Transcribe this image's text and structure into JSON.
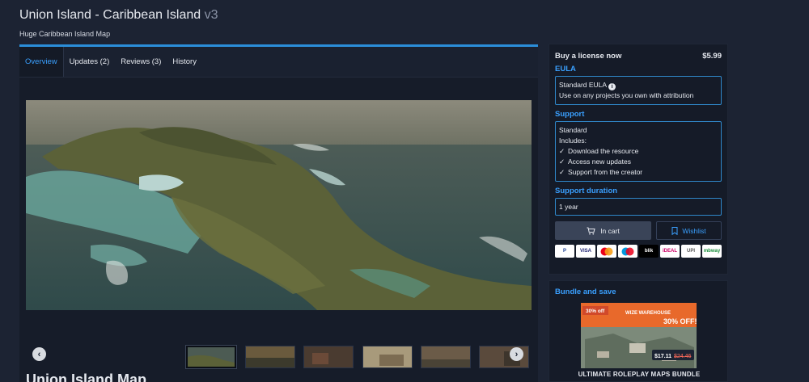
{
  "header": {
    "title": "Union Island - Caribbean Island",
    "version": "v3",
    "subtitle": "Huge Caribbean Island Map"
  },
  "tabs": [
    {
      "label": "Overview",
      "active": true
    },
    {
      "label": "Updates (2)"
    },
    {
      "label": "Reviews (3)"
    },
    {
      "label": "History"
    }
  ],
  "content": {
    "heading": "Union Island Map"
  },
  "gallery": {
    "prev_icon": "chevron-left-icon",
    "next_icon": "chevron-right-icon",
    "thumbnail_count": 6,
    "active_index": 0
  },
  "buy": {
    "title": "Buy a license now",
    "price": "$5.99",
    "eula_label": "EULA",
    "eula_name": "Standard EULA",
    "eula_desc": "Use on any projects you own with attribution",
    "support_label": "Support",
    "support_name": "Standard",
    "support_includes": "Includes:",
    "support_features": [
      "Download the resource",
      "Access new updates",
      "Support from the creator"
    ],
    "duration_label": "Support duration",
    "duration_value": "1 year",
    "cart_label": "In cart",
    "wishlist_label": "Wishlist",
    "payment_methods": [
      "P",
      "VISA",
      "mastercard",
      "maestro",
      "blik",
      "iDEAL",
      "UPI",
      "mbway"
    ]
  },
  "bundle": {
    "title": "Bundle and save",
    "name": "ULTIMATE ROLEPLAY MAPS BUNDLE",
    "discount_badge": "30% off",
    "promo_text": "30% OFF!",
    "brand": "WIZE WAREHOUSE",
    "sale_price": "$17.11",
    "original_price": "$24.46"
  },
  "colors": {
    "background": "#1c2333",
    "accent": "#3aa0ff",
    "panel": "#151b28"
  }
}
